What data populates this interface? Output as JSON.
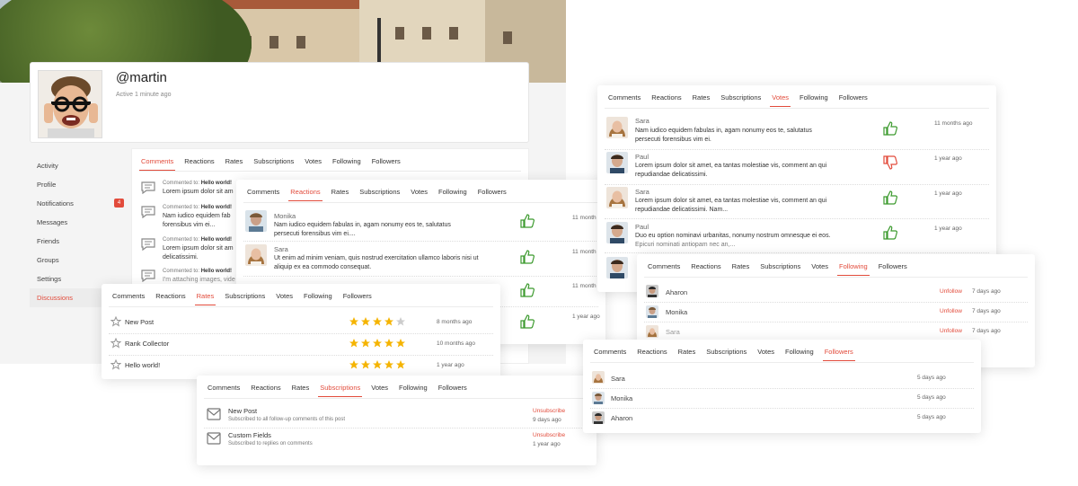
{
  "profile": {
    "username": "@martin",
    "status": "Active 1 minute ago"
  },
  "sidebar": {
    "items": [
      {
        "label": "Activity"
      },
      {
        "label": "Profile"
      },
      {
        "label": "Notifications",
        "badge": "4"
      },
      {
        "label": "Messages"
      },
      {
        "label": "Friends"
      },
      {
        "label": "Groups"
      },
      {
        "label": "Settings"
      },
      {
        "label": "Discussions",
        "active": true
      }
    ]
  },
  "tabs": [
    "Comments",
    "Reactions",
    "Rates",
    "Subscriptions",
    "Votes",
    "Following",
    "Followers"
  ],
  "comments": {
    "active_tab": "Comments",
    "items": [
      {
        "meta_prefix": "Commented to:",
        "meta_topic": "Hello world!",
        "text": "Lorem ipsum dolor sit am"
      },
      {
        "meta_prefix": "Commented to:",
        "meta_topic": "Hello world!",
        "text": "Nam iudico equidem fab",
        "text2": "forensibus vim ei..."
      },
      {
        "meta_prefix": "Commented to:",
        "meta_topic": "Hello world!",
        "text": "Lorem ipsum dolor sit am",
        "text2": "delicatissimi."
      },
      {
        "meta_prefix": "Commented to:",
        "meta_topic": "Hello world!",
        "text": "I'm attaching images, vide"
      }
    ]
  },
  "reactions": {
    "active_tab": "Reactions",
    "items": [
      {
        "name": "Monika",
        "text": "Nam iudico equidem fabulas in, agam nonumy eos te, salutatus",
        "text2": "persecuti forensibus vim ei....",
        "time": "11 month"
      },
      {
        "name": "Sara",
        "text": "Ut enim ad minim veniam, quis nostrud exercitation ullamco laboris nisi ut",
        "text2": "aliquip ex ea commodo consequat.",
        "time": "11 month"
      },
      {
        "name": "",
        "text": "",
        "text2": "",
        "time": "11 month"
      },
      {
        "name": "",
        "text": "",
        "text2": "",
        "time": "1 year ago"
      }
    ]
  },
  "votes": {
    "active_tab": "Votes",
    "items": [
      {
        "name": "Sara",
        "text": "Nam iudico equidem fabulas in, agam nonumy eos te, salutatus",
        "text2": "persecuti forensibus vim ei.",
        "vote": "up",
        "time": "11 months ago"
      },
      {
        "name": "Paul",
        "text": "Lorem ipsum dolor sit amet, ea tantas molestiae vis, comment an qui",
        "text2": "repudiandae delicatissimi.",
        "vote": "down",
        "time": "1 year ago"
      },
      {
        "name": "Sara",
        "text": "Lorem ipsum dolor sit amet, ea tantas molestiae vis, comment an qui",
        "text2": "repudiandae delicatissimi. Nam...",
        "vote": "up",
        "time": "1 year ago"
      },
      {
        "name": "Paul",
        "text": "Duo eu option nominavi urbanitas, nonumy nostrum omnesque ei eos.",
        "text2": "Epicuri nominati antiopam nec an,...",
        "vote": "up",
        "time": "1 year ago"
      }
    ]
  },
  "rates": {
    "active_tab": "Rates",
    "items": [
      {
        "title": "New Post",
        "rating": 4,
        "time": "8 months ago"
      },
      {
        "title": "Rank Collector",
        "rating": 5,
        "time": "10 months ago"
      },
      {
        "title": "Hello world!",
        "rating": 5,
        "time": "1 year ago"
      }
    ]
  },
  "following": {
    "active_tab": "Following",
    "action_label": "Unfollow",
    "items": [
      {
        "name": "Aharon",
        "time": "7 days ago"
      },
      {
        "name": "Monika",
        "time": "7 days ago"
      },
      {
        "name": "Sara",
        "time": "7 days ago"
      }
    ]
  },
  "subscriptions": {
    "active_tab": "Subscriptions",
    "action_label": "Unsubscribe",
    "items": [
      {
        "title": "New Post",
        "desc": "Subscribed to all follow-up comments of this post",
        "time": "9 days ago"
      },
      {
        "title": "Custom Fields",
        "desc": "Subscribed to replies on comments",
        "time": "1 year ago"
      }
    ]
  },
  "followers": {
    "active_tab": "Followers",
    "items": [
      {
        "name": "Sara",
        "time": "5 days ago"
      },
      {
        "name": "Monika",
        "time": "5 days ago"
      },
      {
        "name": "Aharon",
        "time": "5 days ago"
      }
    ]
  },
  "colors": {
    "accent": "#e24b3b",
    "thumb_up": "#3c9a2e",
    "thumb_down": "#e24b3b",
    "star": "#f5b400",
    "star_empty": "#cccccc"
  },
  "icons": {
    "comment": "comment-icon",
    "thumb_up": "thumbs-up-icon",
    "thumb_down": "thumbs-down-icon",
    "star": "star-icon",
    "mail": "envelope-icon"
  }
}
